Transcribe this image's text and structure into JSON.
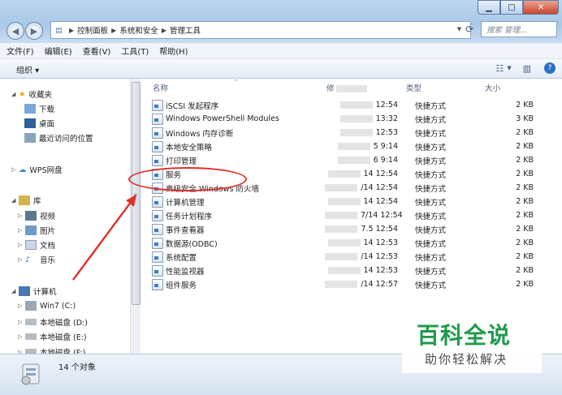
{
  "window": {
    "minimize_glyph": "▁",
    "maximize_glyph": "□",
    "close_glyph": "✕"
  },
  "address": {
    "segments": [
      "控制面板",
      "系统和安全",
      "管理工具"
    ],
    "search_placeholder": "搜索 管理..."
  },
  "menu": [
    "文件(F)",
    "编辑(E)",
    "查看(V)",
    "工具(T)",
    "帮助(H)"
  ],
  "toolbar": {
    "organize": "组织 ▾"
  },
  "sidebar": {
    "favorites": {
      "label": "收藏夹",
      "items": [
        "下载",
        "桌面",
        "最近访问的位置"
      ]
    },
    "wps": "WPS网盘",
    "library": {
      "label": "库",
      "items": [
        "视频",
        "图片",
        "文档",
        "音乐"
      ]
    },
    "computer": {
      "label": "计算机",
      "items": [
        "Win7 (C:)",
        "本地磁盘 (D:)",
        "本地磁盘 (E:)",
        "本地磁盘 (F:)"
      ]
    }
  },
  "columns": {
    "name": "名称",
    "date": "修",
    "type": "类型",
    "size": "大小"
  },
  "files": [
    {
      "name": "iSCSI 发起程序",
      "date": "12:54",
      "type": "快捷方式",
      "size": "2 KB"
    },
    {
      "name": "Windows PowerShell Modules",
      "date": "13:32",
      "type": "快捷方式",
      "size": "3 KB"
    },
    {
      "name": "Windows 内存诊断",
      "date": "12:53",
      "type": "快捷方式",
      "size": "2 KB"
    },
    {
      "name": "本地安全策略",
      "date": "5 9:14",
      "type": "快捷方式",
      "size": "2 KB"
    },
    {
      "name": "打印管理",
      "date": "6 9:14",
      "type": "快捷方式",
      "size": "2 KB"
    },
    {
      "name": "服务",
      "date": "14 12:54",
      "type": "快捷方式",
      "size": "2 KB"
    },
    {
      "name": "高级安全 Windows 防火墙",
      "date": "/14 12:54",
      "type": "快捷方式",
      "size": "2 KB"
    },
    {
      "name": "计算机管理",
      "date": "14 12:54",
      "type": "快捷方式",
      "size": "2 KB"
    },
    {
      "name": "任务计划程序",
      "date": "7/14 12:54",
      "type": "快捷方式",
      "size": "2 KB"
    },
    {
      "name": "事件查看器",
      "date": "7.5 12:54",
      "type": "快捷方式",
      "size": "2 KB"
    },
    {
      "name": "数据源(ODBC)",
      "date": "14 12:53",
      "type": "快捷方式",
      "size": "2 KB"
    },
    {
      "name": "系统配置",
      "date": "/14 12:53",
      "type": "快捷方式",
      "size": "2 KB"
    },
    {
      "name": "性能监视器",
      "date": "14 12:53",
      "type": "快捷方式",
      "size": "2 KB"
    },
    {
      "name": "组件服务",
      "date": "/14 12:57",
      "type": "快捷方式",
      "size": "2 KB"
    }
  ],
  "status": {
    "count": "14 个对象"
  },
  "watermark": {
    "title": "百科全说",
    "subtitle": "助你轻松解决"
  },
  "colors": {
    "annotation": "#e0302a",
    "watermark_green": "#1f9a4a"
  }
}
